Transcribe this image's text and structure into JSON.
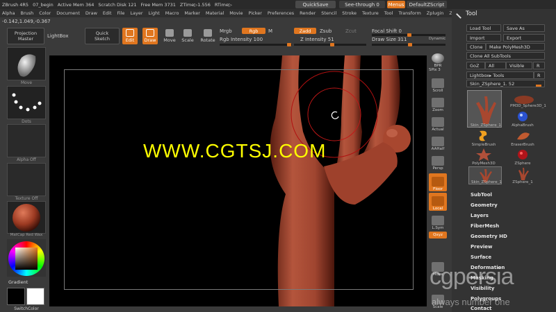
{
  "titlebar": {
    "app": "ZBrush 4R5",
    "doc": "07_begin",
    "active_mem": "Active Mem 364",
    "scratch": "Scratch Disk 121",
    "free_mem": "Free Mem 3731",
    "ztime": "ZTime▷1.556",
    "rtime": "RTime▷",
    "quicksave": "QuickSave",
    "seethrough": "See-through  0",
    "menus": "Menus",
    "defaultzscript": "DefaultZScript"
  },
  "menubar": [
    "Alpha",
    "Brush",
    "Color",
    "Document",
    "Draw",
    "Edit",
    "File",
    "Layer",
    "Light",
    "Macro",
    "Marker",
    "Material",
    "Movie",
    "Picker",
    "Preferences",
    "Render",
    "Stencil",
    "Stroke",
    "Texture",
    "Tool",
    "Transform",
    "Zplugin",
    "Zscript"
  ],
  "coords": "-0.142,1.049,-0.367",
  "toolbar": {
    "projection_master_1": "Projection",
    "projection_master_2": "Master",
    "lightbox": "LightBox",
    "quick_sketch_1": "Quick",
    "quick_sketch_2": "Sketch",
    "edit": "Edit",
    "draw": "Draw",
    "move": "Move",
    "scale": "Scale",
    "rotate": "Rotate",
    "mrgb": "Mrgb",
    "rgb": "Rgb",
    "m": "M",
    "rgb_intensity": "Rgb Intensity 100",
    "zadd": "Zadd",
    "zsub": "Zsub",
    "zcut": "Zcut",
    "z_intensity": "Z Intensity 51",
    "focal_shift": "Focal Shift 0",
    "draw_size": "Draw Size 311",
    "dynamic": "Dynamic"
  },
  "leftshelf": {
    "move": "Move",
    "dots": "Dots",
    "alpha": "Alpha Off",
    "texture": "Texture Off",
    "matcap": "MatCap Red Wax",
    "gradient": "Gradient",
    "switchcolor": "SwitchColor"
  },
  "canvas": {
    "watermark": "WWW.CGTSJ.COM"
  },
  "rightshelf": {
    "bpr": "BPR",
    "spix": "SPix 3",
    "scroll": "Scroll",
    "zoom": "Zoom",
    "actual": "Actual",
    "aahalf": "AAHalf",
    "persp": "Persp",
    "floor": "Floor",
    "local": "Local",
    "lsym": "L.Sym",
    "qxyz": "Qxyz",
    "move": "Move",
    "scale": "Scale"
  },
  "palette": {
    "title": "Tool",
    "load_tool": "Load Tool",
    "save_as": "Save As",
    "import": "Import",
    "export": "Export",
    "clone": "Clone",
    "make_polymesh": "Make PolyMesh3D",
    "clone_all": "Clone All SubTools",
    "goz": "GoZ",
    "all": "All",
    "visible": "Visible",
    "r": "R",
    "lightbox_tools": "Lightbox▸ Tools",
    "current_tool": "Skin_ZSphere_1. 52",
    "thumbs": [
      "Skin_ZSphere_1",
      "PM3D_Sphere3D_1",
      "AlphaBrush",
      "SimpleBrush",
      "EraserBrush",
      "PolyMesh3D",
      "ZSphere",
      "Skin_ZSphere_1",
      "ZSphere_1"
    ],
    "sections": [
      "SubTool",
      "Geometry",
      "Layers",
      "FiberMesh",
      "Geometry HD",
      "Preview",
      "Surface",
      "Deformation",
      "Masking",
      "Visibility",
      "Polygroups",
      "Contact"
    ]
  },
  "branding": {
    "logo": "cgpersia",
    "slogan": "always number one"
  },
  "colors": {
    "accent": "#e0761f",
    "skin": "#a84a34",
    "watermark": "#ffff00"
  }
}
